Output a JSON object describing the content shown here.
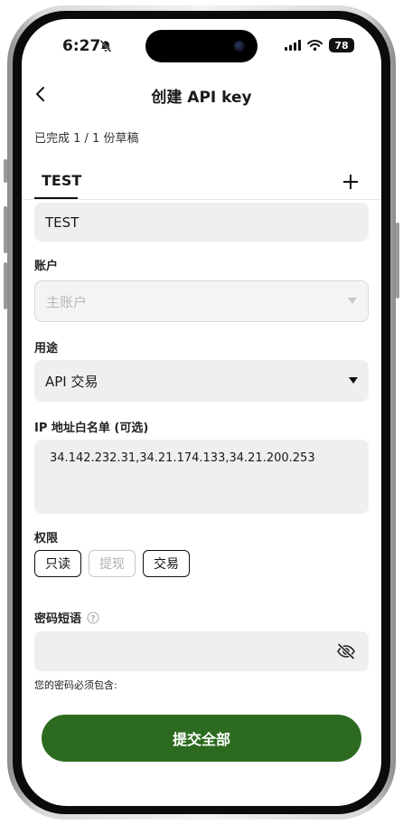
{
  "status": {
    "time": "6:27",
    "battery": "78"
  },
  "header": {
    "title": "创建 API key"
  },
  "progress": "已完成 1 / 1 份草稿",
  "tabs": [
    {
      "label": "TEST"
    }
  ],
  "form": {
    "name_value": "TEST",
    "account": {
      "label": "账户",
      "value": "主账户"
    },
    "purpose": {
      "label": "用途",
      "value": "API 交易"
    },
    "ip_whitelist": {
      "label": "IP 地址白名单 (可选)",
      "value": "34.142.232.31,34.21.174.133,34.21.200.253"
    },
    "permissions": {
      "label": "权限",
      "options": [
        "只读",
        "提现",
        "交易"
      ],
      "selected": [
        "只读",
        "交易"
      ]
    },
    "passphrase": {
      "label": "密码短语",
      "value": "",
      "hint": "您的密码必须包含:"
    }
  },
  "submit_label": "提交全部",
  "colors": {
    "accent": "#2c6b1f",
    "field_bg": "#efefef"
  }
}
